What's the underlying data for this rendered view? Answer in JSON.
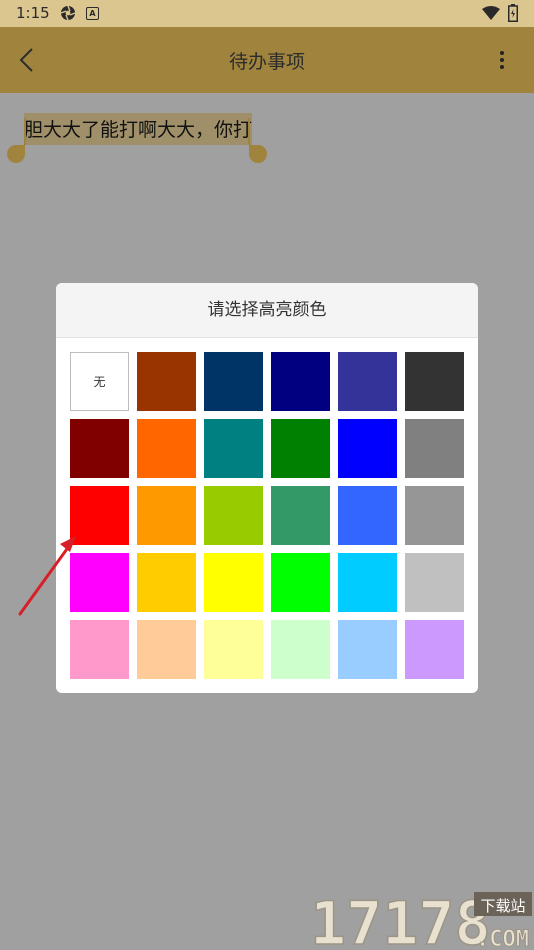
{
  "status_bar": {
    "time": "1:15",
    "badge_letter": "A"
  },
  "app_bar": {
    "title": "待办事项"
  },
  "note": {
    "text": "胆大大了能打啊大大，你打"
  },
  "dialog": {
    "title": "请选择高亮颜色",
    "none_label": "无",
    "rows": [
      [
        "none",
        "#993300",
        "#003366",
        "#000080",
        "#333399",
        "#333333"
      ],
      [
        "#800000",
        "#FF6600",
        "#008080",
        "#008000",
        "#0000FF",
        "#808080"
      ],
      [
        "#FF0000",
        "#FF9900",
        "#99CC00",
        "#339966",
        "#3366FF",
        "#969696"
      ],
      [
        "#FF00FF",
        "#FFCC00",
        "#FFFF00",
        "#00FF00",
        "#00CCFF",
        "#C0C0C0"
      ],
      [
        "#FF99CC",
        "#FFCC99",
        "#FFFF99",
        "#CCFFCC",
        "#99CCFF",
        "#CC99FF"
      ]
    ]
  },
  "watermark": {
    "number": "17178",
    "tag": "下载站",
    "domain": ".COM"
  },
  "colors": {
    "app_bar": "#A0843E",
    "status_bar": "#DCC690",
    "scrim": "#A0A0A0",
    "arrow": "#D81E26"
  }
}
